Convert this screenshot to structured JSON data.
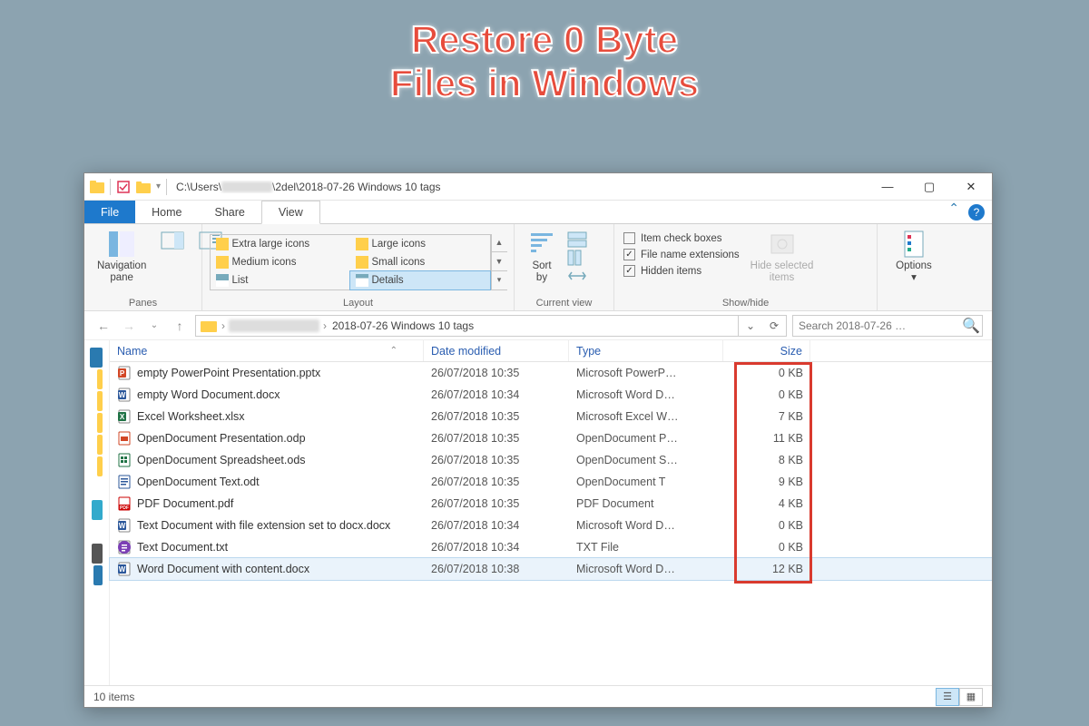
{
  "banner": {
    "line1": "Restore 0 Byte",
    "line2": "Files in Windows"
  },
  "titlebar": {
    "path_prefix": "C:\\Users\\",
    "path_suffix": "\\2del\\2018-07-26 Windows 10 tags"
  },
  "tabs": {
    "file": "File",
    "home": "Home",
    "share": "Share",
    "view": "View"
  },
  "ribbon": {
    "panes": {
      "nav": "Navigation\npane",
      "label": "Panes"
    },
    "layout": {
      "label": "Layout",
      "opts": [
        "Extra large icons",
        "Large icons",
        "Medium icons",
        "Small icons",
        "List",
        "Details"
      ]
    },
    "current": {
      "sort": "Sort\nby",
      "label": "Current view"
    },
    "showhide": {
      "chk1": "Item check boxes",
      "chk2": "File name extensions",
      "chk3": "Hidden items",
      "hide": "Hide selected\nitems",
      "label": "Show/hide"
    },
    "options": "Options"
  },
  "nav": {
    "crumb": "2018-07-26 Windows 10 tags",
    "search_placeholder": "Search 2018-07-26 …"
  },
  "columns": {
    "name": "Name",
    "date": "Date modified",
    "type": "Type",
    "size": "Size"
  },
  "files": [
    {
      "icon": "ppt",
      "name": "empty PowerPoint Presentation.pptx",
      "date": "26/07/2018 10:35",
      "type": "Microsoft PowerP…",
      "size": "0 KB"
    },
    {
      "icon": "word",
      "name": "empty Word Document.docx",
      "date": "26/07/2018 10:34",
      "type": "Microsoft Word D…",
      "size": "0 KB"
    },
    {
      "icon": "xls",
      "name": "Excel Worksheet.xlsx",
      "date": "26/07/2018 10:35",
      "type": "Microsoft Excel W…",
      "size": "7 KB"
    },
    {
      "icon": "odp",
      "name": "OpenDocument Presentation.odp",
      "date": "26/07/2018 10:35",
      "type": "OpenDocument P…",
      "size": "11 KB"
    },
    {
      "icon": "ods",
      "name": "OpenDocument Spreadsheet.ods",
      "date": "26/07/2018 10:35",
      "type": "OpenDocument S…",
      "size": "8 KB"
    },
    {
      "icon": "odt",
      "name": "OpenDocument Text.odt",
      "date": "26/07/2018 10:35",
      "type": "OpenDocument T",
      "size": "9 KB"
    },
    {
      "icon": "pdf",
      "name": "PDF Document.pdf",
      "date": "26/07/2018 10:35",
      "type": "PDF Document",
      "size": "4 KB"
    },
    {
      "icon": "word",
      "name": "Text Document with file extension set to docx.docx",
      "date": "26/07/2018 10:34",
      "type": "Microsoft Word D…",
      "size": "0 KB"
    },
    {
      "icon": "txt",
      "name": "Text Document.txt",
      "date": "26/07/2018 10:34",
      "type": "TXT File",
      "size": "0 KB"
    },
    {
      "icon": "word",
      "name": "Word Document with content.docx",
      "date": "26/07/2018 10:38",
      "type": "Microsoft Word D…",
      "size": "12 KB",
      "selected": true
    }
  ],
  "status": {
    "count": "10 items"
  }
}
